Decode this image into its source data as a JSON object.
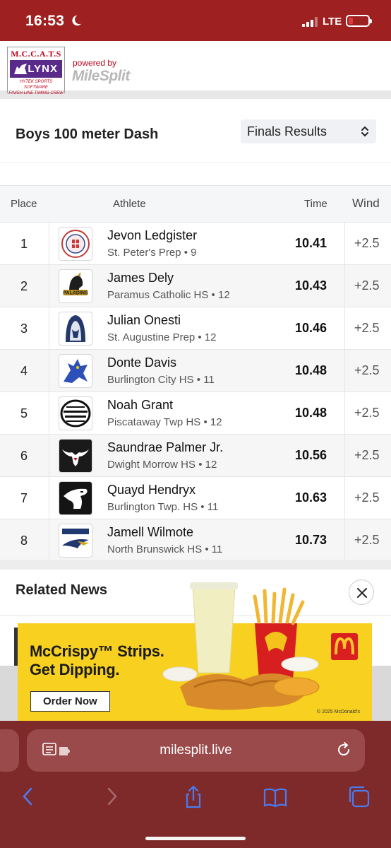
{
  "status_bar": {
    "time": "16:53",
    "network": "LTE",
    "bg_color": "#9f2020"
  },
  "header": {
    "logo_top": "M.C.C.A.T.S",
    "logo_main": "LYNX",
    "logo_sub_1": "HYTEK SPORTS SOFTWARE",
    "logo_sub_2": "FINISH LINE TIMING CREW",
    "powered_by": "powered by",
    "brand": "MileSplit"
  },
  "event": {
    "title": "Boys 100 meter Dash",
    "view_select": "Finals Results"
  },
  "table": {
    "headers": {
      "place": "Place",
      "athlete": "Athlete",
      "time": "Time",
      "wind": "Wind"
    },
    "rows": [
      {
        "place": "1",
        "name": "Jevon Ledgister",
        "school": "St. Peter's Prep • 9",
        "time": "10.41",
        "wind": "+2.5",
        "logo": "st-peters-prep-seal-icon"
      },
      {
        "place": "2",
        "name": "James Dely",
        "school": "Paramus Catholic HS • 12",
        "time": "10.43",
        "wind": "+2.5",
        "logo": "paladins-helmet-icon"
      },
      {
        "place": "3",
        "name": "Julian Onesti",
        "school": "St. Augustine Prep • 12",
        "time": "10.46",
        "wind": "+2.5",
        "logo": "hermit-hood-icon"
      },
      {
        "place": "4",
        "name": "Donte Davis",
        "school": "Burlington City HS • 11",
        "time": "10.48",
        "wind": "+2.5",
        "logo": "blue-devil-icon"
      },
      {
        "place": "5",
        "name": "Noah Grant",
        "school": "Piscataway Twp HS • 12",
        "time": "10.48",
        "wind": "+2.5",
        "logo": "piscataway-track-field-icon"
      },
      {
        "place": "6",
        "name": "Saundrae Palmer Jr.",
        "school": "Dwight Morrow HS • 12",
        "time": "10.56",
        "wind": "+2.5",
        "logo": "longhorn-icon"
      },
      {
        "place": "7",
        "name": "Quayd Hendryx",
        "school": "Burlington Twp. HS • 11",
        "time": "10.63",
        "wind": "+2.5",
        "logo": "falcon-head-icon"
      },
      {
        "place": "8",
        "name": "Jamell Wilmote",
        "school": "North Brunswick HS • 11",
        "time": "10.73",
        "wind": "+2.5",
        "logo": "raiders-eagle-icon"
      }
    ]
  },
  "related_news": {
    "title": "Related News"
  },
  "ad": {
    "headline_1": "McCrispy™ Strips.",
    "headline_2": "Get Dipping.",
    "cta": "Order Now",
    "copyright": "© 2025 McDonald's",
    "bg_color": "#f7d020"
  },
  "browser": {
    "url": "milesplit.live",
    "bg_color": "#7e2a2a"
  }
}
